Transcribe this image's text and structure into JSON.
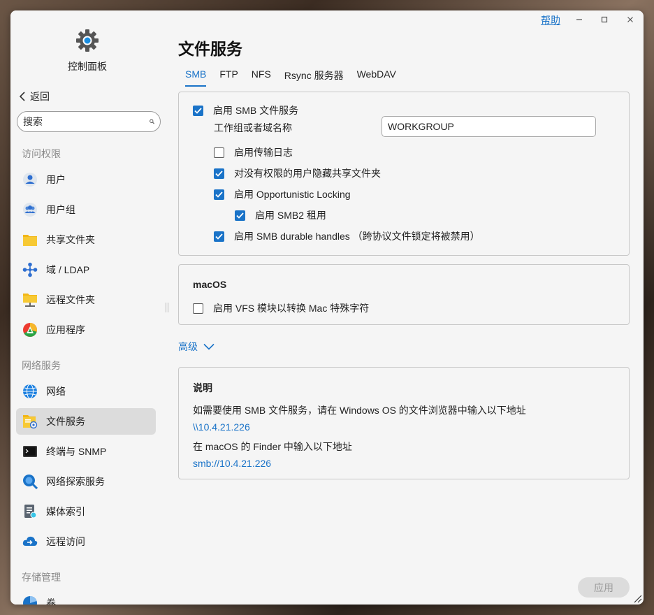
{
  "window": {
    "help_label": "帮助",
    "title": "文件服务"
  },
  "sidebar": {
    "app_title": "控制面板",
    "back_label": "返回",
    "search_placeholder": "搜索",
    "sections": [
      {
        "label": "访问权限",
        "items": [
          {
            "label": "用户",
            "icon": "user-icon"
          },
          {
            "label": "用户组",
            "icon": "user-group-icon"
          },
          {
            "label": "共享文件夹",
            "icon": "shared-folder-icon"
          },
          {
            "label": "域 / LDAP",
            "icon": "domain-ldap-icon"
          },
          {
            "label": "远程文件夹",
            "icon": "remote-folder-icon"
          },
          {
            "label": "应用程序",
            "icon": "application-icon"
          }
        ]
      },
      {
        "label": "网络服务",
        "items": [
          {
            "label": "网络",
            "icon": "network-globe-icon"
          },
          {
            "label": "文件服务",
            "icon": "file-service-icon",
            "active": true
          },
          {
            "label": "终端与 SNMP",
            "icon": "terminal-icon"
          },
          {
            "label": "网络探索服务",
            "icon": "network-discovery-icon"
          },
          {
            "label": "媒体索引",
            "icon": "media-index-icon"
          },
          {
            "label": "远程访问",
            "icon": "remote-access-icon"
          }
        ]
      },
      {
        "label": "存储管理",
        "items": [
          {
            "label": "卷",
            "icon": "volume-pie-icon"
          }
        ]
      }
    ]
  },
  "tabs": [
    {
      "label": "SMB",
      "active": true
    },
    {
      "label": "FTP"
    },
    {
      "label": "NFS"
    },
    {
      "label": "Rsync 服务器"
    },
    {
      "label": "WebDAV"
    }
  ],
  "smb": {
    "enable_label": "启用 SMB 文件服务",
    "enable_checked": true,
    "workgroup_label": "工作组或者域名称",
    "workgroup_value": "WORKGROUP",
    "options": [
      {
        "label": "启用传输日志",
        "checked": false
      },
      {
        "label": "对没有权限的用户隐藏共享文件夹",
        "checked": true
      },
      {
        "label": "启用 Opportunistic Locking",
        "checked": true
      },
      {
        "label": "启用 SMB2 租用",
        "checked": true
      },
      {
        "label": "启用 SMB durable handles （跨协议文件锁定将被禁用）",
        "checked": true
      }
    ]
  },
  "macos": {
    "heading": "macOS",
    "vfs_label": "启用 VFS 模块以转换 Mac 特殊字符",
    "vfs_checked": false
  },
  "advanced_label": "高级",
  "info": {
    "heading": "说明",
    "line1": "如需要使用 SMB 文件服务，请在 Windows OS 的文件浏览器中输入以下地址",
    "windows_path": "\\\\10.4.21.226",
    "line2": "在 macOS 的 Finder 中输入以下地址",
    "mac_path": "smb://10.4.21.226"
  },
  "apply_label": "应用",
  "colors": {
    "accent": "#1a73c8"
  }
}
